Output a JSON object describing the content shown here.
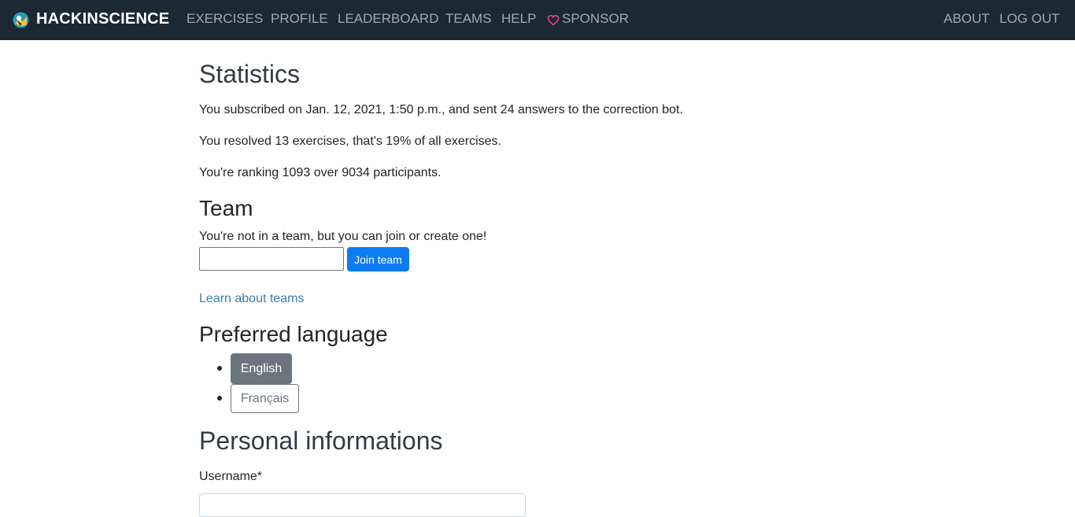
{
  "nav": {
    "brand": "HACKINSCIENCE",
    "items": {
      "exercises": "EXERCISES",
      "profile": "PROFILE",
      "leaderboard": "LEADERBOARD",
      "teams": "TEAMS",
      "help": "HELP",
      "sponsor": "SPONSOR",
      "about": "ABOUT",
      "logout": "LOG OUT"
    },
    "colors": {
      "background": "#1c2832",
      "link": "#a1a8ae",
      "heart": "#e83e8c"
    }
  },
  "statistics": {
    "title": "Statistics",
    "subscribed": "You subscribed on Jan. 12, 2021, 1:50 p.m., and sent 24 answers to the correction bot.",
    "resolved": "You resolved 13 exercises, that's 19% of all exercises.",
    "ranking": "You're ranking 1093 over 9034 participants."
  },
  "team": {
    "title": "Team",
    "status": "You're not in a team, but you can join or create one!",
    "input_value": "",
    "join_button": "Join team",
    "learn_link": "Learn about teams"
  },
  "language": {
    "title": "Preferred language",
    "options": [
      "English",
      "Français"
    ],
    "selected": "English"
  },
  "personal": {
    "title": "Personal informations",
    "username_label": "Username*",
    "username_value": ""
  },
  "colors": {
    "primary": "#0d7bf2",
    "secondary": "#6c757d",
    "link": "#3d7eb0"
  }
}
